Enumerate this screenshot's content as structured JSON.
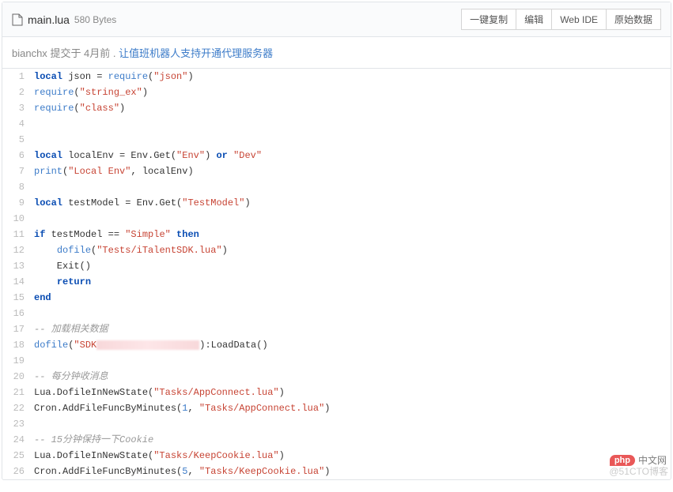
{
  "header": {
    "file_name": "main.lua",
    "file_size": "580 Bytes",
    "buttons": {
      "copy": "一键复制",
      "edit": "编辑",
      "webide": "Web IDE",
      "raw": "原始数据"
    }
  },
  "commit": {
    "author": "bianchx",
    "meta": "提交于 4月前 .",
    "message": "让值班机器人支持开通代理服务器"
  },
  "code": [
    {
      "n": 1,
      "t": [
        [
          "kw",
          "local"
        ],
        [
          "",
          " json = "
        ],
        [
          "fn",
          "require"
        ],
        [
          "",
          "("
        ],
        [
          "str",
          "\"json\""
        ],
        [
          "",
          ")"
        ]
      ]
    },
    {
      "n": 2,
      "t": [
        [
          "fn",
          "require"
        ],
        [
          "",
          "("
        ],
        [
          "str",
          "\"string_ex\""
        ],
        [
          "",
          ")"
        ]
      ]
    },
    {
      "n": 3,
      "t": [
        [
          "fn",
          "require"
        ],
        [
          "",
          "("
        ],
        [
          "str",
          "\"class\""
        ],
        [
          "",
          ")"
        ]
      ]
    },
    {
      "n": 4,
      "t": [
        [
          "",
          ""
        ]
      ]
    },
    {
      "n": 5,
      "t": [
        [
          "",
          ""
        ]
      ]
    },
    {
      "n": 6,
      "t": [
        [
          "kw",
          "local"
        ],
        [
          "",
          " localEnv = Env.Get("
        ],
        [
          "str",
          "\"Env\""
        ],
        [
          "",
          ") "
        ],
        [
          "kw",
          "or"
        ],
        [
          "",
          " "
        ],
        [
          "str",
          "\"Dev\""
        ]
      ]
    },
    {
      "n": 7,
      "t": [
        [
          "fn",
          "print"
        ],
        [
          "",
          "("
        ],
        [
          "str",
          "\"Local Env\""
        ],
        [
          "",
          ", localEnv)"
        ]
      ]
    },
    {
      "n": 8,
      "t": [
        [
          "",
          ""
        ]
      ]
    },
    {
      "n": 9,
      "t": [
        [
          "kw",
          "local"
        ],
        [
          "",
          " testModel = Env.Get("
        ],
        [
          "str",
          "\"TestModel\""
        ],
        [
          "",
          ")"
        ]
      ]
    },
    {
      "n": 10,
      "t": [
        [
          "",
          ""
        ]
      ]
    },
    {
      "n": 11,
      "t": [
        [
          "kw",
          "if"
        ],
        [
          "",
          " testModel == "
        ],
        [
          "str",
          "\"Simple\""
        ],
        [
          "",
          " "
        ],
        [
          "kw",
          "then"
        ]
      ]
    },
    {
      "n": 12,
      "t": [
        [
          "",
          "    "
        ],
        [
          "fn",
          "dofile"
        ],
        [
          "",
          "("
        ],
        [
          "str",
          "\"Tests/iTalentSDK.lua\""
        ],
        [
          "",
          ")"
        ]
      ]
    },
    {
      "n": 13,
      "t": [
        [
          "",
          "    Exit()"
        ]
      ]
    },
    {
      "n": 14,
      "t": [
        [
          "",
          "    "
        ],
        [
          "kw",
          "return"
        ]
      ]
    },
    {
      "n": 15,
      "t": [
        [
          "kw",
          "end"
        ]
      ]
    },
    {
      "n": 16,
      "t": [
        [
          "",
          ""
        ]
      ]
    },
    {
      "n": 17,
      "t": [
        [
          "com",
          "-- 加载相关数据"
        ]
      ]
    },
    {
      "n": 18,
      "t": [
        [
          "fn",
          "dofile"
        ],
        [
          "",
          "("
        ],
        [
          "str",
          "\"SDK"
        ],
        [
          "redact",
          ""
        ],
        [
          "",
          ")"
        ],
        [
          "",
          ":LoadData()"
        ]
      ]
    },
    {
      "n": 19,
      "t": [
        [
          "",
          ""
        ]
      ]
    },
    {
      "n": 20,
      "t": [
        [
          "com",
          "-- 每分钟收消息"
        ]
      ]
    },
    {
      "n": 21,
      "t": [
        [
          "",
          "Lua.DofileInNewState("
        ],
        [
          "str",
          "\"Tasks/AppConnect.lua\""
        ],
        [
          "",
          ")"
        ]
      ]
    },
    {
      "n": 22,
      "t": [
        [
          "",
          "Cron.AddFileFuncByMinutes("
        ],
        [
          "num",
          "1"
        ],
        [
          "",
          ", "
        ],
        [
          "str",
          "\"Tasks/AppConnect.lua\""
        ],
        [
          "",
          ")"
        ]
      ]
    },
    {
      "n": 23,
      "t": [
        [
          "",
          ""
        ]
      ]
    },
    {
      "n": 24,
      "t": [
        [
          "com",
          "-- 15分钟保持一下Cookie"
        ]
      ]
    },
    {
      "n": 25,
      "t": [
        [
          "",
          "Lua.DofileInNewState("
        ],
        [
          "str",
          "\"Tasks/KeepCookie.lua\""
        ],
        [
          "",
          ")"
        ]
      ]
    },
    {
      "n": 26,
      "t": [
        [
          "",
          "Cron.AddFileFuncByMinutes("
        ],
        [
          "num",
          "5"
        ],
        [
          "",
          ", "
        ],
        [
          "str",
          "\"Tasks/KeepCookie.lua\""
        ],
        [
          "",
          ")"
        ]
      ]
    }
  ],
  "watermark": {
    "php_badge": "php",
    "php_text": "中文网",
    "cto": "@51CTO博客"
  }
}
